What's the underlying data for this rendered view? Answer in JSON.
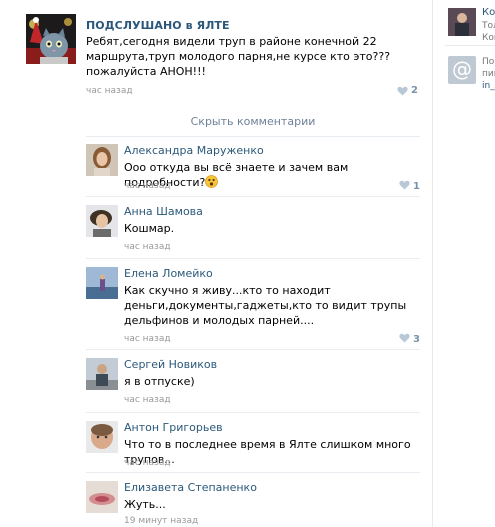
{
  "post": {
    "author": "ПОДСЛУШАНО в ЯЛТЕ",
    "text": "Ребят,сегодня видели труп в районе конечной 22 маршрута,труп молодого парня,не курсе кто это??? пожалуйста АНОН!!!",
    "time": "час назад",
    "likes": "2"
  },
  "hide_comments_label": "Скрыть комментарии",
  "comments": [
    {
      "name": "Александра Маруженко",
      "text": "Ооо откуда вы всё знаете и зачем вам подробности?",
      "time": "час назад",
      "likes": "1"
    },
    {
      "name": "Анна Шамова",
      "text": "Кошмар.",
      "time": "час назад",
      "likes": ""
    },
    {
      "name": "Елена Ломейко",
      "text": "Как скучно я живу...кто то находит деньги,документы,гаджеты,кто то видит трупы дельфинов и молодых парней....",
      "time": "час назад",
      "likes": "3"
    },
    {
      "name": "Сергей Новиков",
      "text": "я в отпуске)",
      "time": "час назад",
      "likes": ""
    },
    {
      "name": "Антон Григорьев",
      "text": "Что то в последнее время в Ялте слишком много трупов...",
      "time": "час назад",
      "likes": ""
    },
    {
      "name": "Елизавета Степаненко",
      "text": "Жуть...",
      "time": "19 минут назад",
      "likes": ""
    }
  ],
  "right_column": {
    "item1_title": "Ком",
    "item1_sub": "Тол",
    "item1_sub2": "Кон",
    "item2_line1": "По",
    "item2_line2": "пиш",
    "item2_line3": "in_v",
    "item2_icon": "at-icon"
  },
  "colors": {
    "link": "#2b587a",
    "muted": "#999999",
    "like": "#7a93a9"
  }
}
